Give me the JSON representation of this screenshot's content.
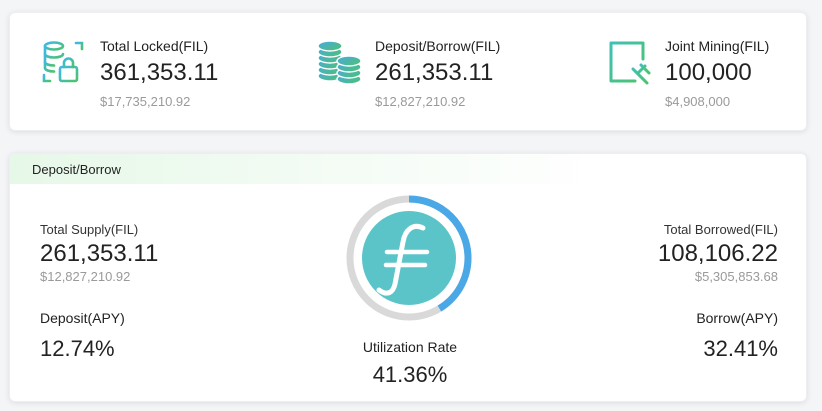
{
  "summary": [
    {
      "label": "Total Locked(FIL)",
      "value": "361,353.11",
      "usd": "$17,735,210.92",
      "icon": "database-lock-icon"
    },
    {
      "label": "Deposit/Borrow(FIL)",
      "value": "261,353.11",
      "usd": "$12,827,210.92",
      "icon": "coin-stack-icon"
    },
    {
      "label": "Joint Mining(FIL)",
      "value": "100,000",
      "usd": "$4,908,000",
      "icon": "mining-document-icon"
    }
  ],
  "deposit_borrow": {
    "title": "Deposit/Borrow",
    "total_supply_label": "Total Supply(FIL)",
    "total_supply_value": "261,353.11",
    "total_supply_usd": "$12,827,210.92",
    "deposit_apy_label": "Deposit(APY)",
    "deposit_apy_value": "12.74%",
    "total_borrowed_label": "Total Borrowed(FIL)",
    "total_borrowed_value": "108,106.22",
    "total_borrowed_usd": "$5,305,853.68",
    "borrow_apy_label": "Borrow(APY)",
    "borrow_apy_value": "32.41%",
    "utilization_label": "Utilization Rate",
    "utilization_value": "41.36%",
    "utilization_fraction": 0.4136,
    "logo_icon": "filecoin-logo-icon"
  },
  "colors": {
    "gauge_track": "#d9d9d9",
    "gauge_fill": "#4aa8e6",
    "logo_bg": "#5bc4c8",
    "icon_teal": "#3fc1b6",
    "icon_blue": "#4f8fe0",
    "icon_green": "#4cc36a"
  }
}
